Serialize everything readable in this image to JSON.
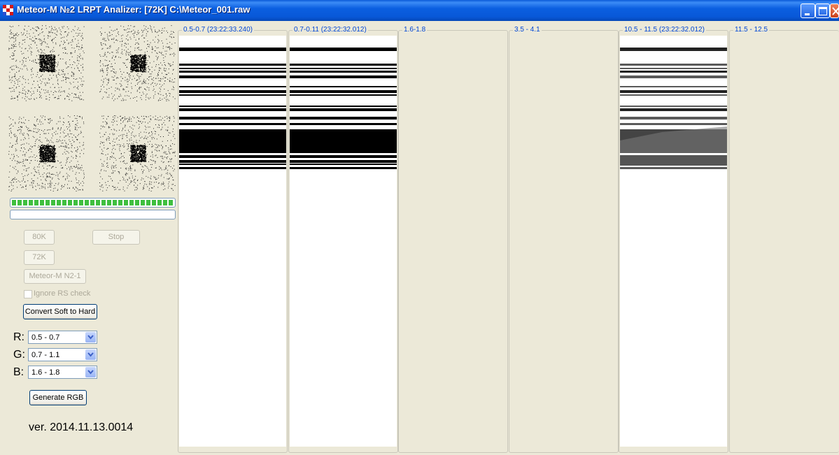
{
  "window": {
    "title": "Meteor-M №2 LRPT Analizer: [72K] C:\\Meteor_001.raw",
    "controls": [
      "minimize-icon",
      "maximize-icon",
      "close-icon"
    ]
  },
  "constellations": [
    "constellation-plot",
    "constellation-plot",
    "constellation-plot",
    "constellation-plot"
  ],
  "progress": {
    "sync_level": 1.0,
    "file_progress": 0.0
  },
  "buttons": {
    "b80k": "80K",
    "stop": "Stop",
    "b72k": "72K",
    "meteor": "Meteor-M N2-1",
    "convert": "Convert Soft to Hard",
    "generate": "Generate RGB"
  },
  "ignore_rs": {
    "label": "Ignore RS check",
    "checked": false
  },
  "rgb": {
    "r_label": "R:",
    "r_value": "0.5 - 0.7",
    "g_label": "G:",
    "g_value": "0.7 - 1.1",
    "b_label": "B:",
    "b_value": "1.6 - 1.8"
  },
  "version": "ver. 2014.11.13.0014",
  "channels": [
    {
      "label": "0.5-0.7 (23:22:33.240)",
      "has_image": true,
      "style": "bars"
    },
    {
      "label": "0.7-0.11 (23:22:32.012)",
      "has_image": true,
      "style": "bars"
    },
    {
      "label": "1.6-1.8",
      "has_image": false
    },
    {
      "label": "3.5 - 4.1",
      "has_image": false
    },
    {
      "label": "10.5 - 11.5 (23:22:32.012)",
      "has_image": true,
      "style": "grey"
    },
    {
      "label": "11.5 - 12.5",
      "has_image": false
    }
  ]
}
